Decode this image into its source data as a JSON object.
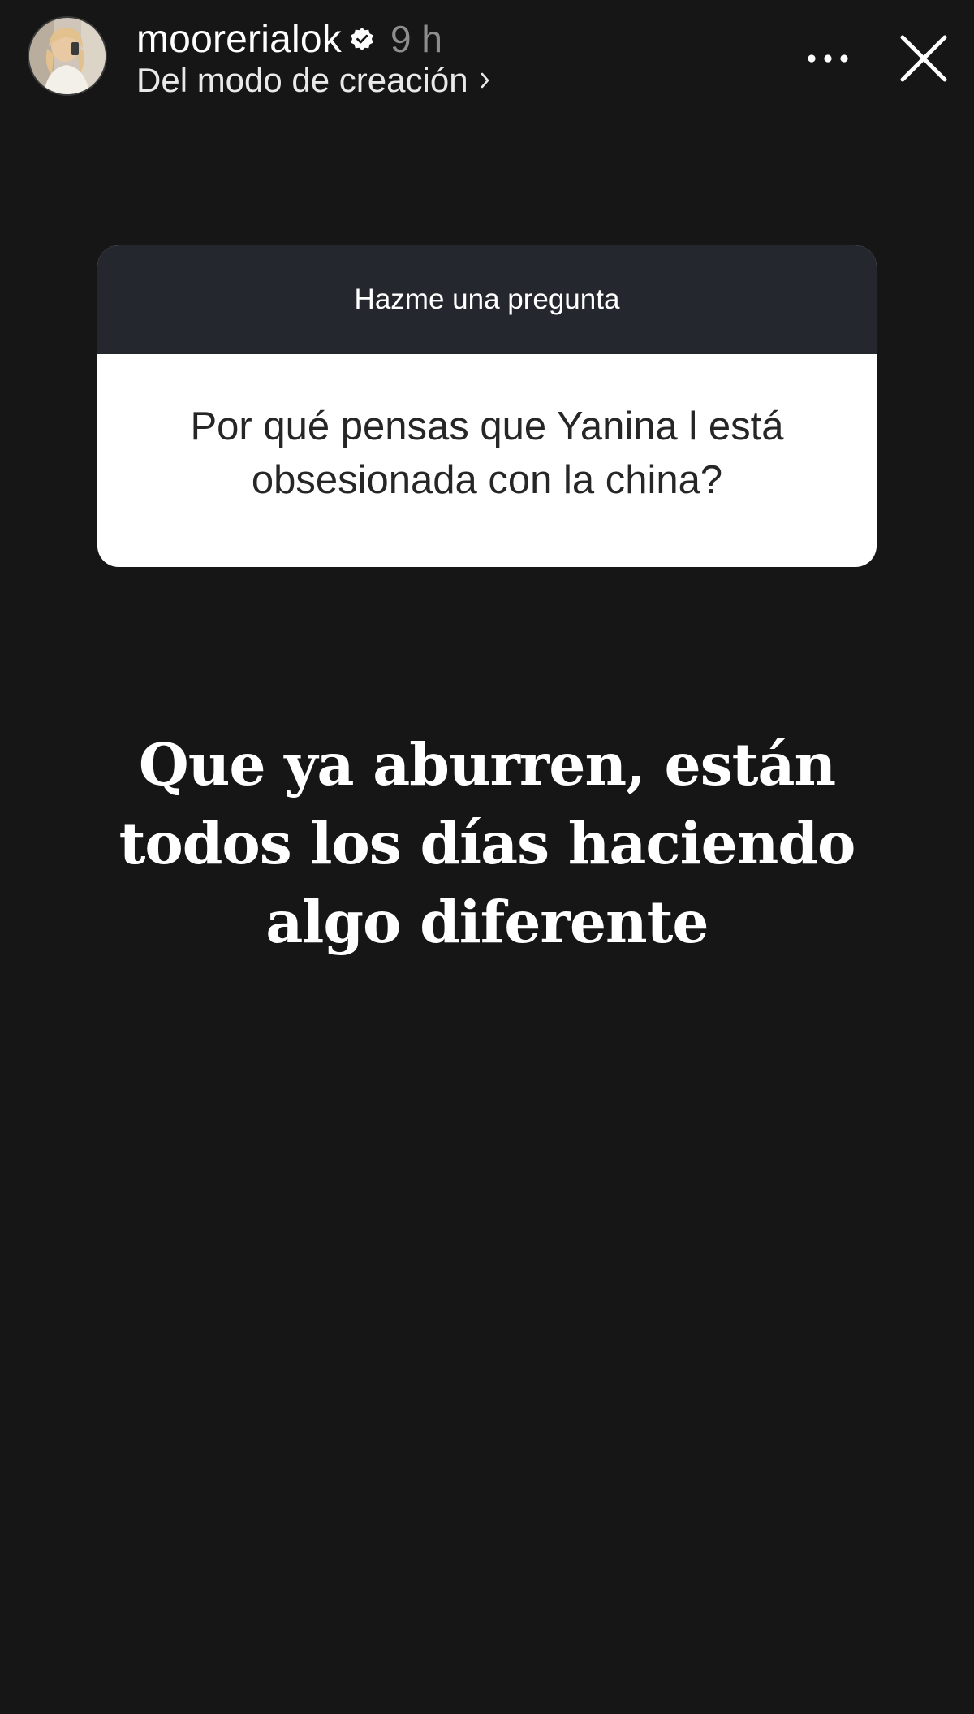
{
  "header": {
    "username": "moorerialok",
    "time_ago": "9 h",
    "subtitle": "Del modo de creación",
    "icons": {
      "avatar": "profile-avatar",
      "verified": "verified-badge-icon",
      "chevron": "chevron-right-icon",
      "more": "more-options-icon",
      "close": "close-icon"
    }
  },
  "sticker": {
    "title": "Hazme una pregunta",
    "question": "Por qué pensas que Yanina l está obsesionada con la china?"
  },
  "answer": {
    "text": "Que ya aburren, están todos los días haciendo algo diferente"
  },
  "colors": {
    "background": "#161616",
    "sticker_header": "#24272d",
    "sticker_body": "#ffffff",
    "question_text": "#262626",
    "time_text": "#8e8e8e"
  }
}
